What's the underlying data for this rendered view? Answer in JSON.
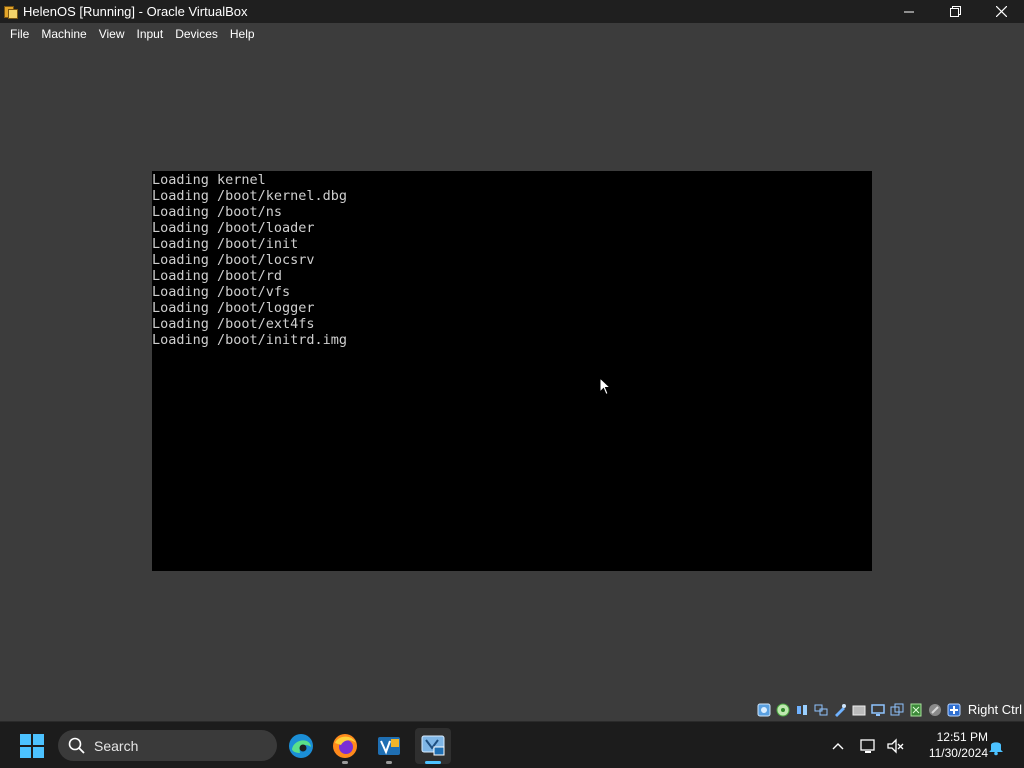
{
  "window": {
    "title": "HelenOS [Running] - Oracle VirtualBox",
    "app_icon": "virtualbox-icon",
    "controls": [
      "minimize-icon",
      "restore-icon",
      "close-icon"
    ]
  },
  "menu": {
    "items": [
      "File",
      "Machine",
      "View",
      "Input",
      "Devices",
      "Help"
    ]
  },
  "console": {
    "lines": [
      "Loading kernel",
      "Loading /boot/kernel.dbg",
      "Loading /boot/ns",
      "Loading /boot/loader",
      "Loading /boot/init",
      "Loading /boot/locsrv",
      "Loading /boot/rd",
      "Loading /boot/vfs",
      "Loading /boot/logger",
      "Loading /boot/ext4fs",
      "Loading /boot/initrd.img"
    ]
  },
  "statusbar": {
    "icons": [
      "hard-disk-icon",
      "optical-drive-icon",
      "audio-icon",
      "network-icon",
      "usb-icon",
      "shared-folders-icon",
      "display-icon",
      "video-capture-icon",
      "cpu-icon",
      "mouse-integration-icon",
      "host-key-icon"
    ],
    "host_key": "Right Ctrl"
  },
  "taskbar": {
    "search_placeholder": "Search",
    "apps": [
      "edge-icon",
      "firefox-icon",
      "virtualbox-manager-icon",
      "virtualbox-vm-icon"
    ],
    "time": "12:51 PM",
    "date": "11/30/2024"
  },
  "colors": {
    "background": "#3c3c3c",
    "titlebar": "#1f1f1f",
    "console_bg": "#000000",
    "console_text": "#cfcfcf",
    "taskbar": "#1c1c1c",
    "accent": "#4cc2ff"
  }
}
